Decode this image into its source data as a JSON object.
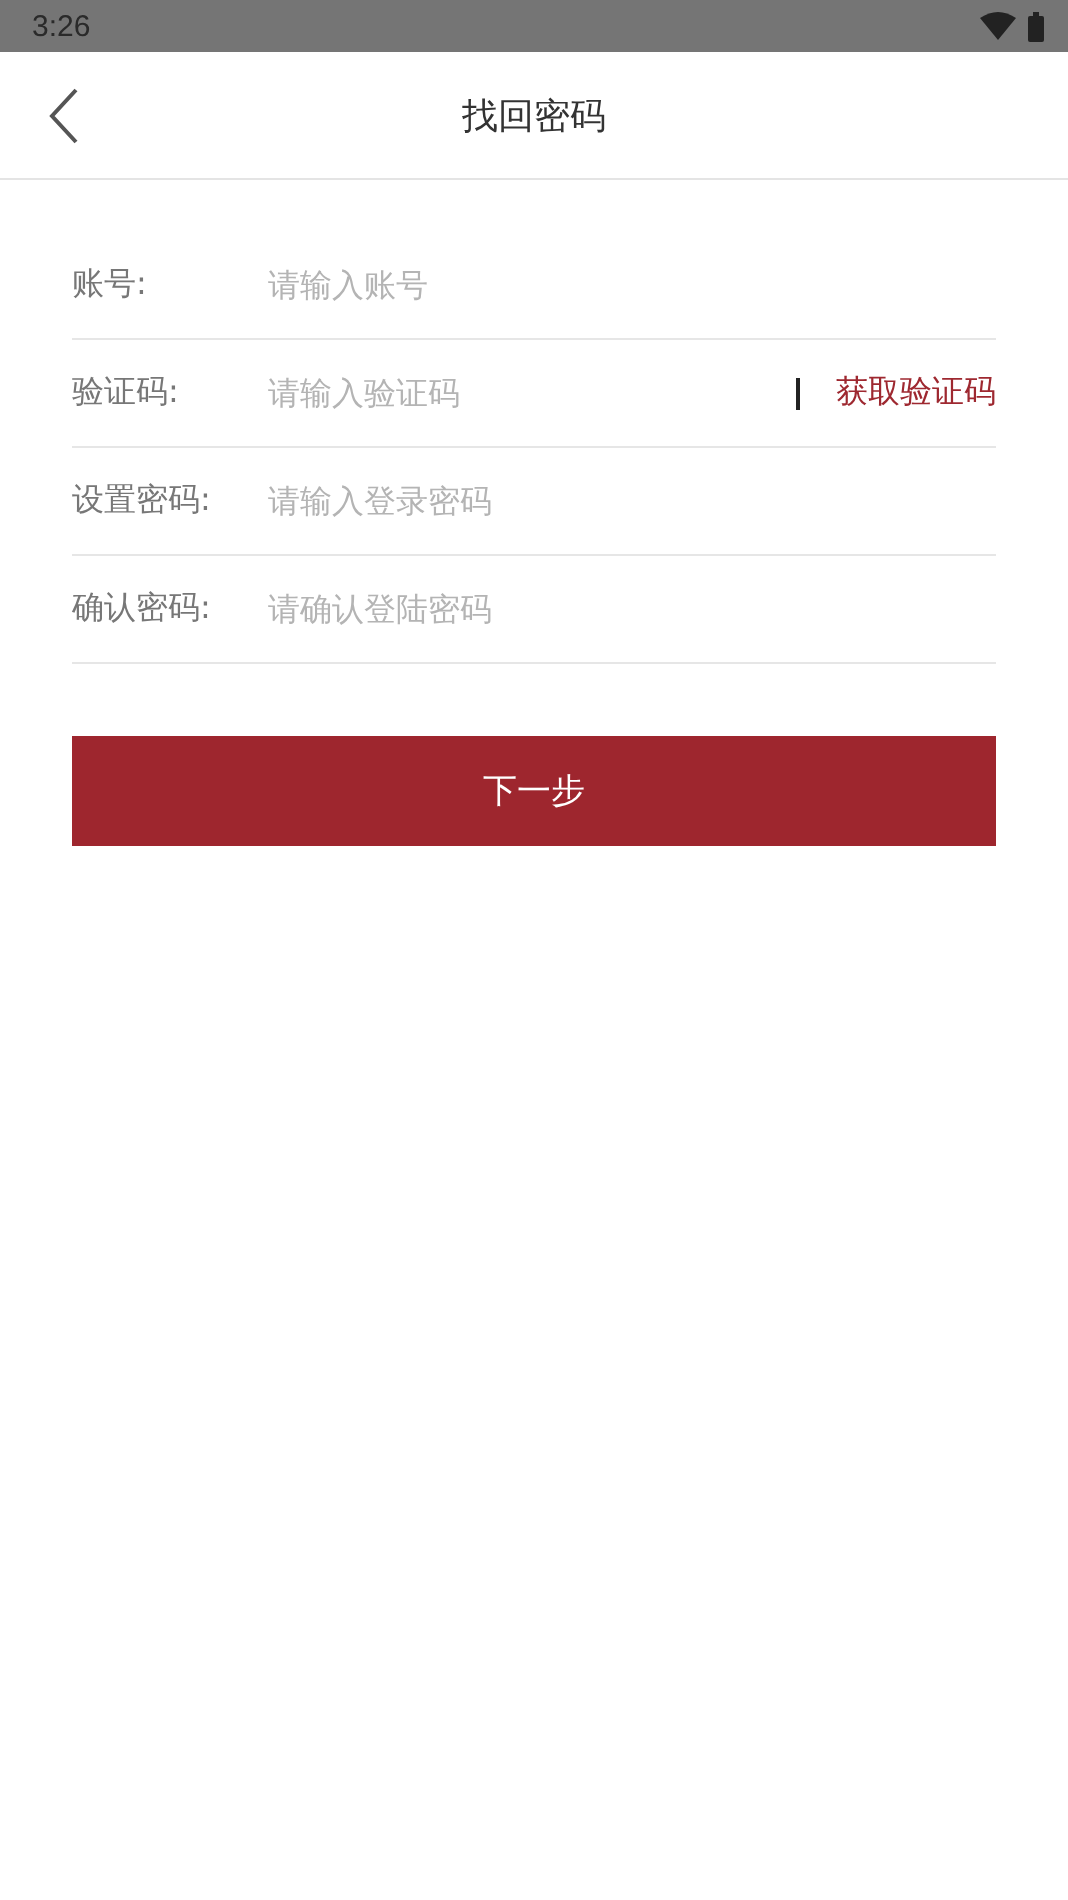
{
  "status_bar": {
    "time": "3:26"
  },
  "header": {
    "title": "找回密码"
  },
  "fields": [
    {
      "label": "账号:",
      "placeholder": "请输入账号",
      "kind": "text"
    },
    {
      "label": "验证码:",
      "placeholder": "请输入验证码",
      "kind": "code",
      "action": "获取验证码"
    },
    {
      "label": "设置密码:",
      "placeholder": "请输入登录密码",
      "kind": "text"
    },
    {
      "label": "确认密码:",
      "placeholder": "请确认登陆密码",
      "kind": "text"
    }
  ],
  "submit": "下一步"
}
